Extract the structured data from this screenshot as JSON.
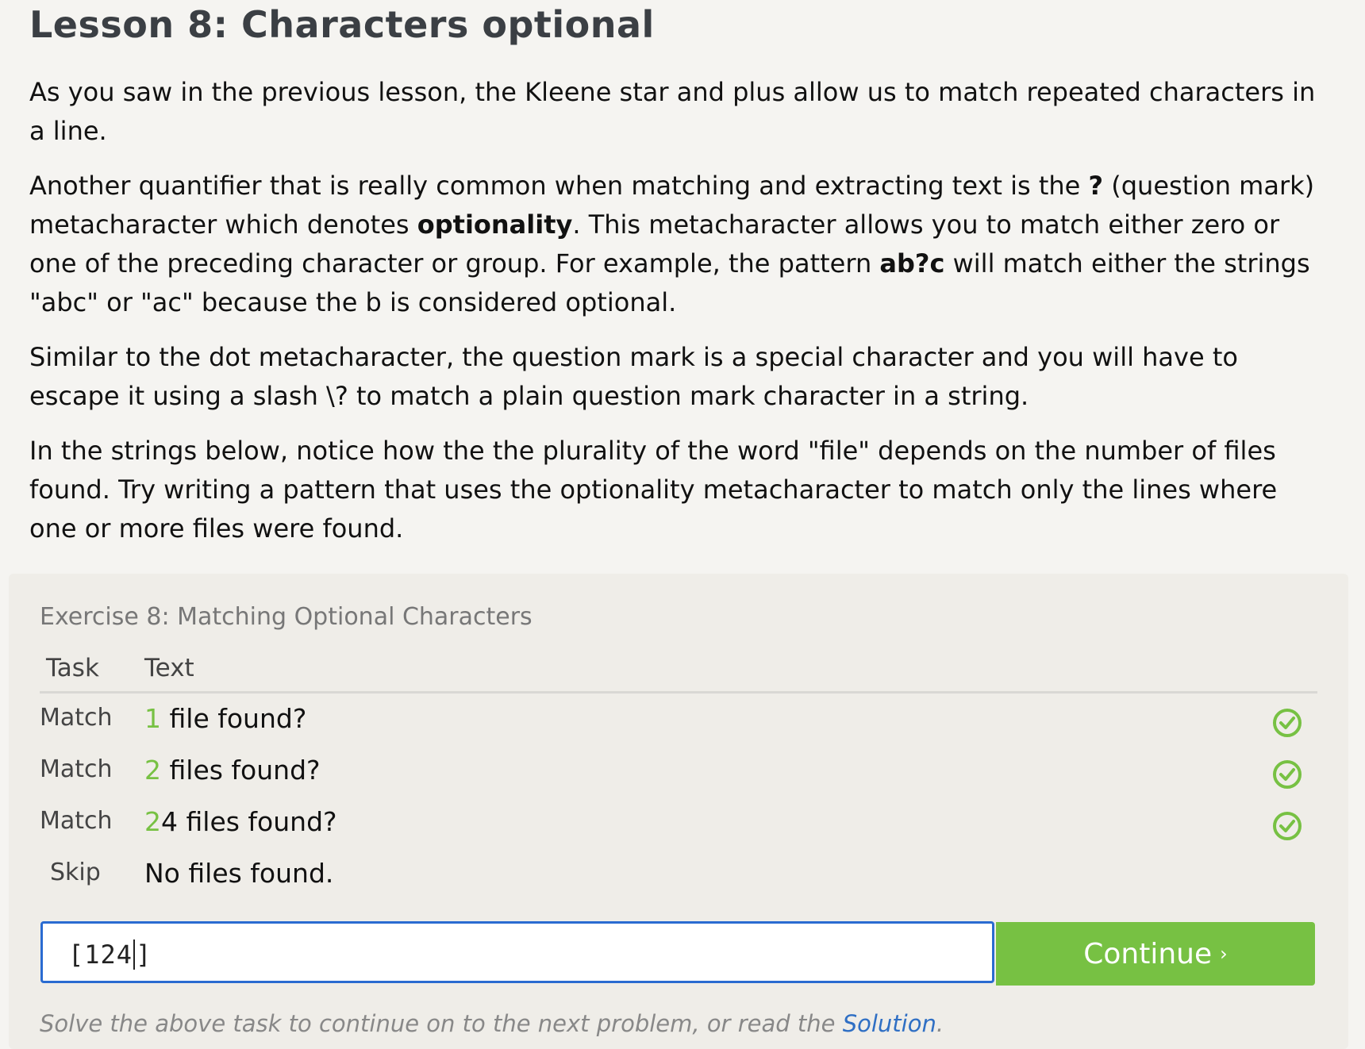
{
  "lesson": {
    "title": "Lesson 8: Characters optional",
    "p1": "As you saw in the previous lesson, the Kleene star and plus allow us to match repeated characters in a line.",
    "p2_a": "Another quantifier that is really common when matching and extracting text is the ",
    "p2_b": "?",
    "p2_c": " (question mark) metacharacter which denotes ",
    "p2_d": "optionality",
    "p2_e": ". This metacharacter allows you to match either zero or one of the preceding character or group. For example, the pattern ",
    "p2_f": "ab?c",
    "p2_g": " will match either the strings \"abc\" or \"ac\" because the b is considered optional.",
    "p3": "Similar to the dot metacharacter, the question mark is a special character and you will have to escape it using a slash \\? to match a plain question mark character in a string.",
    "p4": "In the strings below, notice how the the plurality of the word \"file\" depends on the number of files found. Try writing a pattern that uses the optionality metacharacter to match only the lines where one or more files were found."
  },
  "exercise": {
    "title": "Exercise 8: Matching Optional Characters",
    "col_task": "Task",
    "col_text": "Text",
    "rows": [
      {
        "task": "Match",
        "hl": "1",
        "rest": " file found?",
        "status": "matched"
      },
      {
        "task": "Match",
        "hl": "2",
        "rest": " files found?",
        "status": "matched"
      },
      {
        "task": "Match",
        "hl": "2",
        "rest": "4 files found?",
        "status": "matched"
      },
      {
        "task": "Skip",
        "hl": "",
        "rest": "No files found.",
        "status": "none"
      }
    ],
    "input_before_caret": "[124",
    "input_after_caret": "]",
    "continue_label": "Continue",
    "continue_chevron": "›",
    "hint_text": "Solve the above task to continue on to the next problem, or read the ",
    "hint_link": "Solution",
    "hint_end": "."
  },
  "colors": {
    "accent_green": "#77c143",
    "input_border": "#2a6bd1",
    "link": "#2f6fc4"
  },
  "icons": {
    "row_status": "check-circle-icon"
  }
}
